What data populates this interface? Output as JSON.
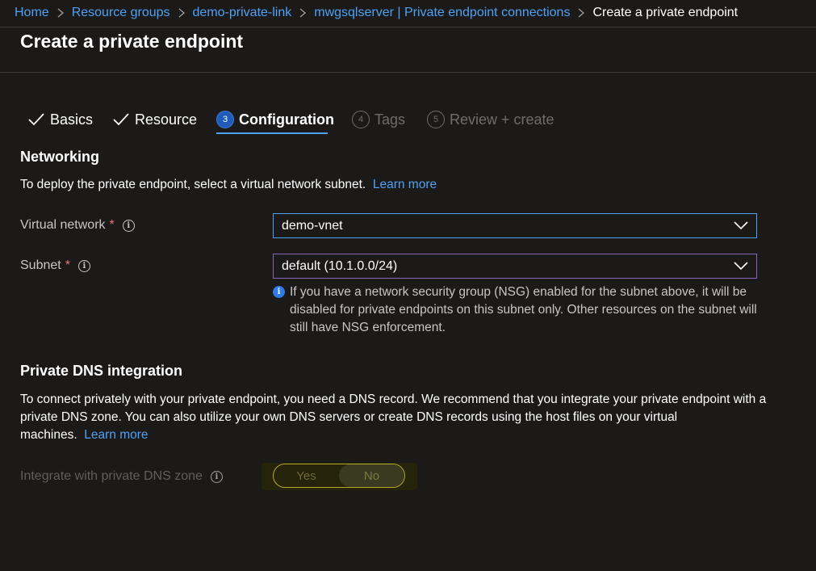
{
  "breadcrumb": {
    "items": [
      "Home",
      "Resource groups",
      "demo-private-link",
      "mwgsqlserver | Private endpoint connections"
    ],
    "current": "Create a private endpoint"
  },
  "page": {
    "title": "Create a private endpoint"
  },
  "tabs": [
    {
      "label": "Basics",
      "state": "done"
    },
    {
      "label": "Resource",
      "state": "done"
    },
    {
      "label": "Configuration",
      "number": "3",
      "state": "active"
    },
    {
      "label": "Tags",
      "number": "4",
      "state": "pending"
    },
    {
      "label": "Review + create",
      "number": "5",
      "state": "pending"
    }
  ],
  "networking": {
    "heading": "Networking",
    "description": "To deploy the private endpoint, select a virtual network subnet.",
    "learn_more": "Learn more",
    "virtual_network": {
      "label": "Virtual network",
      "required": "*",
      "value": "demo-vnet"
    },
    "subnet": {
      "label": "Subnet",
      "required": "*",
      "value": "default (10.1.0.0/24)"
    },
    "nsg_info": "If you have a network security group (NSG) enabled for the subnet above, it will be disabled for private endpoints on this subnet only. Other resources on the subnet will still have NSG enforcement."
  },
  "dns": {
    "heading": "Private DNS integration",
    "description": "To connect privately with your private endpoint, you need a DNS record. We recommend that you integrate your private endpoint with a private DNS zone. You can also utilize your own DNS servers or create DNS records using the host files on your virtual machines.",
    "learn_more": "Learn more",
    "integrate_label": "Integrate with private DNS zone",
    "options": [
      "Yes",
      "No"
    ],
    "selected": "No"
  },
  "icons": {
    "breadcrumb_separator": "chevron-right-icon",
    "completed_step": "checkmark-icon",
    "info": "info-icon",
    "dropdown": "chevron-down-icon"
  },
  "colors": {
    "background": "#1b1a19",
    "link": "#4ea1f3",
    "required": "#f1707b",
    "active_step": "#1f5bb8",
    "toggle_highlight": "#b5a82a"
  }
}
